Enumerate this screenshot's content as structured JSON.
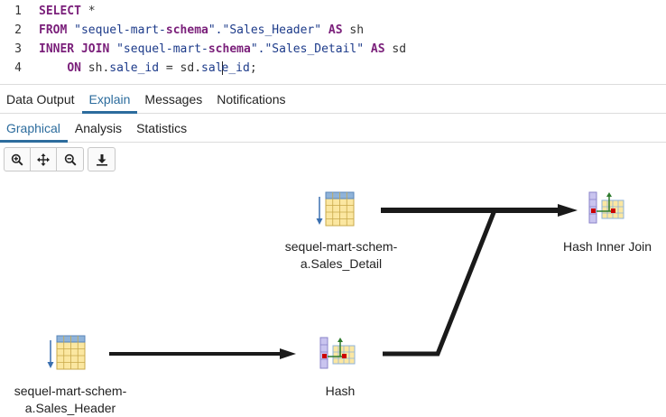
{
  "editor": {
    "lines": [
      {
        "num": "1"
      },
      {
        "num": "2"
      },
      {
        "num": "3"
      },
      {
        "num": "4"
      }
    ],
    "tokens": {
      "l1_kw_select": "SELECT",
      "l1_star": " *",
      "l2_kw_from": "FROM",
      "l2_q1": " \"sequel-mart-",
      "l2_schema": "schema",
      "l2_q2": "\".\"Sales_Header\" ",
      "l2_kw_as": "AS",
      "l2_alias": " sh",
      "l3_kw_inner_join": "INNER JOIN",
      "l3_q1": " \"sequel-mart-",
      "l3_schema": "schema",
      "l3_q2": "\".\"Sales_Detail\" ",
      "l3_kw_as": "AS",
      "l3_alias": " sd",
      "l4_indent": "    ",
      "l4_kw_on": "ON",
      "l4_sh": " sh",
      "l4_dot1": ".",
      "l4_col1": "sale_id",
      "l4_eq": " = sd",
      "l4_dot2": ".",
      "l4_col2a": "sal",
      "l4_col2b": "e_id",
      "l4_semi": ";"
    }
  },
  "tabs": {
    "main": [
      "Data Output",
      "Explain",
      "Messages",
      "Notifications"
    ],
    "main_active": "Explain",
    "sub": [
      "Graphical",
      "Analysis",
      "Statistics"
    ],
    "sub_active": "Graphical"
  },
  "toolbar": {
    "buttons": [
      "zoom-in-icon",
      "move-icon",
      "zoom-out-icon",
      "download-icon"
    ]
  },
  "plan": {
    "nodes": {
      "sales_detail": {
        "label_line1": "sequel-mart-schem-",
        "label_line2": "a.Sales_Detail",
        "icon": "seq-scan-icon"
      },
      "hash_inner_join": {
        "label": "Hash Inner Join",
        "icon": "hash-join-icon"
      },
      "sales_header": {
        "label_line1": "sequel-mart-schem-",
        "label_line2": "a.Sales_Header",
        "icon": "seq-scan-icon"
      },
      "hash": {
        "label": "Hash",
        "icon": "hash-icon"
      }
    },
    "colors": {
      "edge": "#1a1a1a",
      "table_fill": "#fbe7a1",
      "table_header": "#8fb3d9",
      "hash_purple": "#c9c4ef",
      "accent_red": "#cc0000",
      "accent_green": "#2d7a2d"
    }
  }
}
